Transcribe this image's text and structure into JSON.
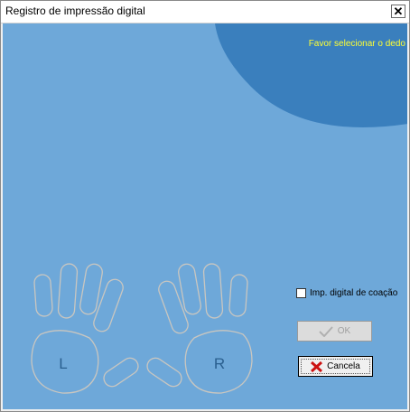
{
  "window": {
    "title": "Registro de impressão digital"
  },
  "titlebar": {
    "close_glyph": "✕"
  },
  "prompt": {
    "text": "Favor selecionar o dedo"
  },
  "hands": {
    "left_label": "L",
    "right_label": "R"
  },
  "coercion": {
    "label": "Imp. digital de coação",
    "checked": false
  },
  "buttons": {
    "ok_label": "OK",
    "cancel_label": "Cancela"
  },
  "colors": {
    "background": "#6ea8d9",
    "blob": "#3a7fbd",
    "prompt_text": "#ffff33",
    "hand_outline": "#c9c6c0",
    "cancel_icon": "#cc1111"
  },
  "icons": {
    "ok": "check-icon",
    "cancel": "x-icon",
    "close": "close-icon"
  }
}
